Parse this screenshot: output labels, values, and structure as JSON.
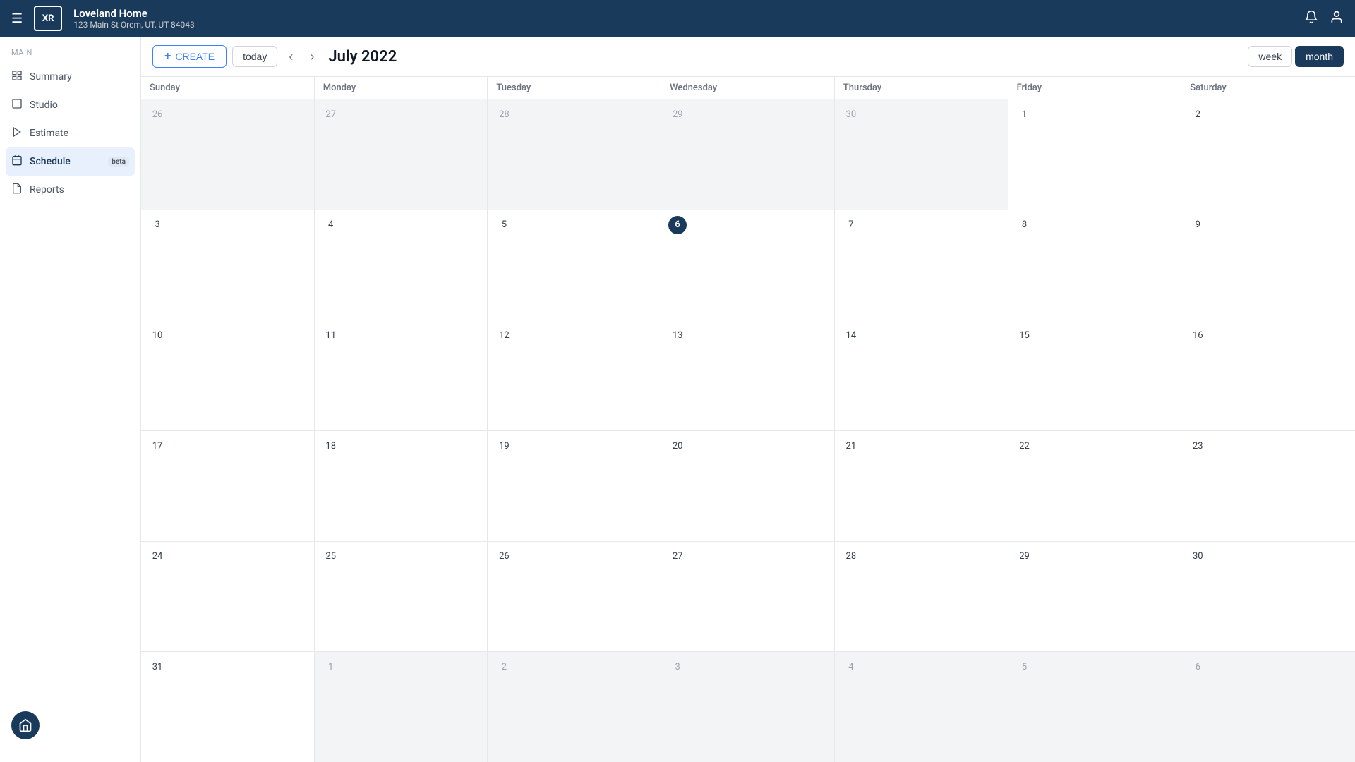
{
  "header": {
    "menu_label": "☰",
    "logo_text": "XR",
    "title": "Loveland Home",
    "subtitle": "123 Main St Orem, UT, UT 84043",
    "bell_icon": "🔔",
    "user_icon": "👤"
  },
  "sidebar": {
    "section_label": "Main",
    "items": [
      {
        "id": "summary",
        "label": "Summary",
        "icon": "⊙",
        "active": false
      },
      {
        "id": "studio",
        "label": "Studio",
        "icon": "⬜",
        "active": false
      },
      {
        "id": "estimate",
        "label": "Estimate",
        "icon": "▷",
        "active": false
      },
      {
        "id": "schedule",
        "label": "Schedule",
        "icon": "📅",
        "active": true,
        "badge": "beta"
      },
      {
        "id": "reports",
        "label": "Reports",
        "icon": "📄",
        "active": false
      }
    ],
    "avatar_icon": "🏠"
  },
  "toolbar": {
    "create_label": "CREATE",
    "today_label": "today",
    "title": "July 2022",
    "week_label": "week",
    "month_label": "month"
  },
  "calendar": {
    "days": [
      "Sunday",
      "Monday",
      "Tuesday",
      "Wednesday",
      "Thursday",
      "Friday",
      "Saturday"
    ],
    "weeks": [
      [
        {
          "num": "26",
          "other": true
        },
        {
          "num": "27",
          "other": true
        },
        {
          "num": "28",
          "other": true
        },
        {
          "num": "29",
          "other": true
        },
        {
          "num": "30",
          "other": true
        },
        {
          "num": "1",
          "other": false
        },
        {
          "num": "2",
          "other": false
        }
      ],
      [
        {
          "num": "3",
          "other": false
        },
        {
          "num": "4",
          "other": false
        },
        {
          "num": "5",
          "other": false
        },
        {
          "num": "6",
          "other": false,
          "today": true
        },
        {
          "num": "7",
          "other": false
        },
        {
          "num": "8",
          "other": false
        },
        {
          "num": "9",
          "other": false
        }
      ],
      [
        {
          "num": "10",
          "other": false
        },
        {
          "num": "11",
          "other": false
        },
        {
          "num": "12",
          "other": false
        },
        {
          "num": "13",
          "other": false
        },
        {
          "num": "14",
          "other": false
        },
        {
          "num": "15",
          "other": false
        },
        {
          "num": "16",
          "other": false
        }
      ],
      [
        {
          "num": "17",
          "other": false
        },
        {
          "num": "18",
          "other": false
        },
        {
          "num": "19",
          "other": false
        },
        {
          "num": "20",
          "other": false
        },
        {
          "num": "21",
          "other": false
        },
        {
          "num": "22",
          "other": false
        },
        {
          "num": "23",
          "other": false
        }
      ],
      [
        {
          "num": "24",
          "other": false
        },
        {
          "num": "25",
          "other": false
        },
        {
          "num": "26",
          "other": false
        },
        {
          "num": "27",
          "other": false
        },
        {
          "num": "28",
          "other": false
        },
        {
          "num": "29",
          "other": false
        },
        {
          "num": "30",
          "other": false
        }
      ],
      [
        {
          "num": "31",
          "other": false
        },
        {
          "num": "1",
          "other": true
        },
        {
          "num": "2",
          "other": true
        },
        {
          "num": "3",
          "other": true
        },
        {
          "num": "4",
          "other": true
        },
        {
          "num": "5",
          "other": true
        },
        {
          "num": "6",
          "other": true
        }
      ]
    ]
  }
}
